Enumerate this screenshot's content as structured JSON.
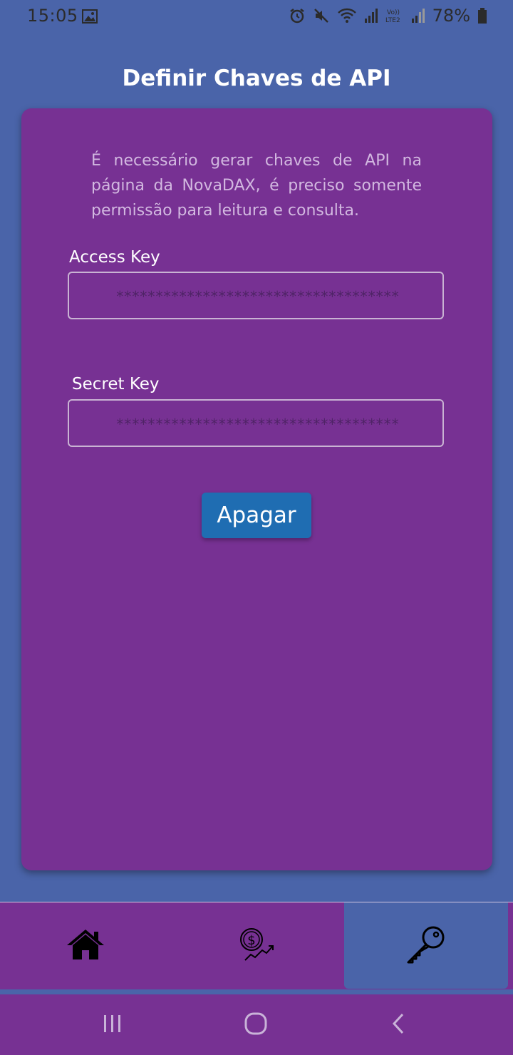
{
  "status_bar": {
    "time": "15:05",
    "battery": "78%",
    "icons": [
      "gallery-icon",
      "alarm-icon",
      "mute-icon",
      "wifi-icon",
      "signal-icon",
      "volte-lte2-icon",
      "signal-icon",
      "battery-icon"
    ]
  },
  "header": {
    "title": "Definir Chaves de API"
  },
  "card": {
    "info_text": "É necessário gerar chaves de API na página da NovaDAX, é preciso somente permissão para leitura e consulta.",
    "access_key": {
      "label": "Access Key",
      "placeholder": "************************************"
    },
    "secret_key": {
      "label": "Secret Key",
      "placeholder": "************************************"
    },
    "button_label": "Apagar"
  },
  "tab_bar": {
    "tabs": [
      {
        "icon": "home-icon",
        "active": false
      },
      {
        "icon": "dollar-growth-icon",
        "active": false
      },
      {
        "icon": "key-icon",
        "active": true
      }
    ]
  },
  "nav_bar": {
    "buttons": [
      "recent-apps-icon",
      "home-circle-icon",
      "back-icon"
    ]
  },
  "colors": {
    "background": "#4a64a9",
    "card": "#773193",
    "button": "#1f6db2",
    "active_tab": "#4a64a9"
  }
}
